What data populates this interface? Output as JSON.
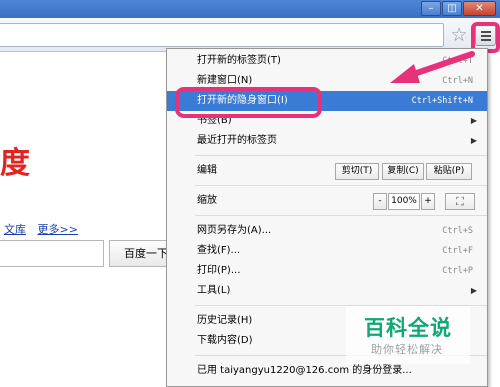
{
  "window": {
    "minimize_glyph": "–",
    "maximize_glyph": "◫",
    "close_glyph": "✕"
  },
  "toolbar": {
    "star_glyph": "☆",
    "menu_icon": "hamburger-menu-icon"
  },
  "page": {
    "logo_fragment": "度",
    "links": [
      "文库",
      "更多>>"
    ],
    "search_button": "百度一下"
  },
  "menu": {
    "new_tab": {
      "label": "打开新的标签页(T)",
      "shortcut": "Ctrl+T"
    },
    "new_window": {
      "label": "新建窗口(N)",
      "shortcut": "Ctrl+N"
    },
    "incognito": {
      "label": "打开新的隐身窗口(I)",
      "shortcut": "Ctrl+Shift+N"
    },
    "bookmarks": {
      "label": "书签(B)"
    },
    "recent_tabs": {
      "label": "最近打开的标签页"
    },
    "edit": {
      "label": "编辑",
      "cut": "剪切(T)",
      "copy": "复制(C)",
      "paste": "粘贴(P)"
    },
    "zoom": {
      "label": "缩放",
      "minus": "-",
      "value": "100%",
      "plus": "+",
      "fullscreen": "⛶"
    },
    "save_as": {
      "label": "网页另存为(A)...",
      "shortcut": "Ctrl+S"
    },
    "find": {
      "label": "查找(F)...",
      "shortcut": "Ctrl+F"
    },
    "print": {
      "label": "打印(P)...",
      "shortcut": "Ctrl+P"
    },
    "tools": {
      "label": "工具(L)"
    },
    "history": {
      "label": "历史记录(H)"
    },
    "downloads": {
      "label": "下载内容(D)"
    },
    "signin": {
      "label": "已用 taiyangyu1220@126.com 的身份登录..."
    }
  },
  "watermark": {
    "title": "百科全说",
    "subtitle": "助你轻松解决"
  },
  "colors": {
    "highlight": "#e8317b",
    "selection": "#3a7bd5",
    "watermark_green": "#10a874"
  }
}
